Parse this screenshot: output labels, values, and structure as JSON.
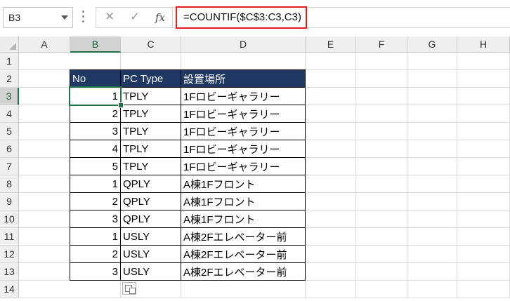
{
  "formula_bar": {
    "name_box": "B3",
    "cancel_icon": "✕",
    "enter_icon": "✓",
    "fx_label": "fx",
    "formula": "=COUNTIF($C$3:C3,C3)",
    "highlight_color": "#e21e1e"
  },
  "columns": [
    "A",
    "B",
    "C",
    "D",
    "E",
    "F",
    "G",
    "H"
  ],
  "rows": [
    "1",
    "2",
    "3",
    "4",
    "5",
    "6",
    "7",
    "8",
    "9",
    "10",
    "11",
    "12",
    "13",
    "14"
  ],
  "selected": {
    "column": "B",
    "row": "3"
  },
  "table": {
    "header_bg": "#1f3864",
    "headers": [
      "No",
      "PC Type",
      "設置場所"
    ],
    "rows": [
      [
        "1",
        "TPLY",
        "1Fロビーギャラリー"
      ],
      [
        "2",
        "TPLY",
        "1Fロビーギャラリー"
      ],
      [
        "3",
        "TPLY",
        "1Fロビーギャラリー"
      ],
      [
        "4",
        "TPLY",
        "1Fロビーギャラリー"
      ],
      [
        "5",
        "TPLY",
        "1Fロビーギャラリー"
      ],
      [
        "1",
        "QPLY",
        "A棟1Fフロント"
      ],
      [
        "2",
        "QPLY",
        "A棟1Fフロント"
      ],
      [
        "3",
        "QPLY",
        "A棟1Fフロント"
      ],
      [
        "1",
        "USLY",
        "A棟2Fエレベーター前"
      ],
      [
        "2",
        "USLY",
        "A棟2Fエレベーター前"
      ],
      [
        "3",
        "USLY",
        "A棟2Fエレベーター前"
      ]
    ]
  },
  "accent_color": "#217346"
}
